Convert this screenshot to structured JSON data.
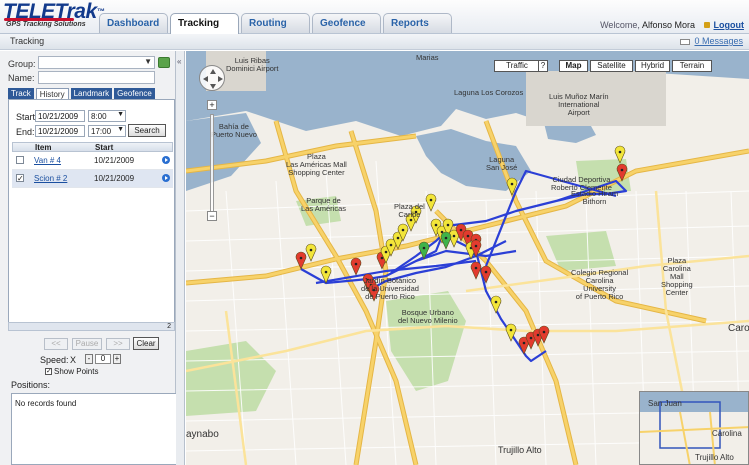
{
  "app": {
    "logo_text": "TELETrak",
    "logo_tagline": "GPS Tracking Solutions"
  },
  "nav": {
    "tabs": [
      {
        "label": "Dashboard",
        "active": false
      },
      {
        "label": "Tracking",
        "active": true
      },
      {
        "label": "Routing",
        "active": false
      },
      {
        "label": "Geofence",
        "active": false
      },
      {
        "label": "Reports",
        "active": false
      }
    ]
  },
  "header": {
    "welcome": "Welcome,",
    "user": "Alfonso Mora",
    "logout": "Logout"
  },
  "subheader": {
    "title": "Tracking",
    "messages": "0 Messages"
  },
  "filters": {
    "group_label": "Group:",
    "group_value": "",
    "name_label": "Name:",
    "name_value": ""
  },
  "subtabs": [
    {
      "label": "Track",
      "active": false
    },
    {
      "label": "History",
      "active": true
    },
    {
      "label": "Landmark",
      "active": false
    },
    {
      "label": "Geofence",
      "active": false
    }
  ],
  "history": {
    "start_label": "Start:",
    "start_date": "10/21/2009",
    "start_time": "8:00",
    "end_label": "End:",
    "end_date": "10/21/2009",
    "end_time": "17:00",
    "search_label": "Search",
    "columns": [
      "Item",
      "Start"
    ],
    "rows": [
      {
        "item": "Van # 4",
        "start": "10/21/2009",
        "checked": false
      },
      {
        "item": "Scion # 2",
        "start": "10/21/2009",
        "checked": true
      }
    ],
    "page_count": "2"
  },
  "playback": {
    "prev_label": "<<",
    "pause_label": "Pause",
    "next_label": ">>",
    "clear_label": "Clear",
    "speed_label": "Speed:",
    "speed_x": "X",
    "minus": "-",
    "speed_value": "0",
    "plus": "+",
    "show_points_label": "Show Points",
    "show_points": true
  },
  "positions": {
    "label": "Positions:",
    "empty_text": "No records found"
  },
  "map": {
    "controls": {
      "traffic": "Traffic",
      "traffic_help": "?",
      "map": "Map",
      "satellite": "Satellite",
      "hybrid": "Hybrid",
      "terrain": "Terrain",
      "zoom_in": "+",
      "zoom_out": "−"
    },
    "labels": {
      "luis_ribas": "Luis Ribas\nDominici Airport",
      "marias": "Marias",
      "laguna_los_corozos": "Laguna Los Corozos",
      "luis_munoz_marin": "Luis Muñoz Marín\nInternational\nAirport",
      "bahia_puerto_nuevo": "Bahía de\nPuerto Nuevo",
      "laguna_san_jose": "Laguna\nSan José",
      "ciudad_deportiva": "Ciudad Deportiva\nRoberto Clemente",
      "estadio": "Estadio Hiram\nBithorn",
      "plaza_las_americas": "Plaza\nLas Américas Mall\nShopping Center",
      "parque_las_americas": "Parque de\nLas Américas",
      "plaza_del_caribe": "Plaza del\nCaribe",
      "colegio_regional": "Colegio Regional\nCarolina\nUniversity\nof Puerto Rico",
      "plaza_carolina": "Plaza\nCarolina\nMall\nShopping\nCenter",
      "jardin_botanico": "Jardín Botánico\nde la Universidad\nde Puerto Rico",
      "bosque_urbano": "Bosque Urbano\ndel Nuevo Milenio",
      "guaynabo": "aynabo",
      "trujillo_alto": "Trujillo Alto",
      "carolina": "Caro",
      "ov_san_juan": "San Juan",
      "ov_carolina": "Carolina",
      "ov_trujillo": "Trujillo Alto"
    }
  },
  "colors": {
    "brand_blue": "#123a8c",
    "route_blue": "#2b3fd6",
    "marker_yellow": "#f2e53a",
    "marker_red": "#e23b2e",
    "marker_green": "#3fb34a",
    "water": "#99b3cc",
    "highway": "#f7d26a"
  }
}
